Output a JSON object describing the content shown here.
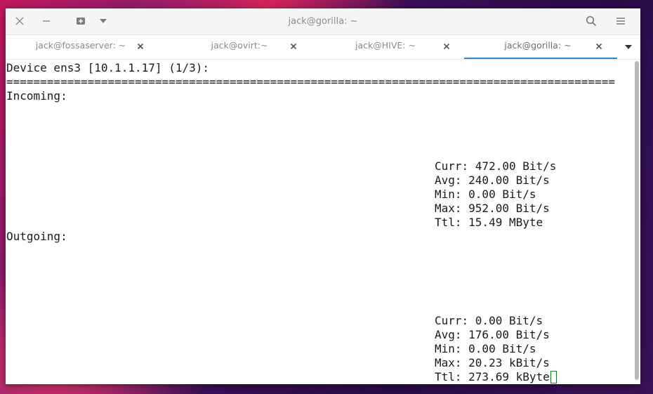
{
  "window": {
    "title": "jack@gorilla: ~"
  },
  "titlebar": {
    "icons": [
      "close-icon",
      "minimize-icon",
      "new-tab-icon",
      "chevron-down-icon",
      "search-icon",
      "hamburger-menu-icon"
    ]
  },
  "tabs": [
    {
      "label": "jack@fossaserver: ~",
      "active": false
    },
    {
      "label": "jack@ovirt:~",
      "active": false
    },
    {
      "label": "jack@HIVE: ~",
      "active": false
    },
    {
      "label": "jack@gorilla: ~",
      "active": true
    }
  ],
  "colors": {
    "accent": "#2f86d6",
    "cursor": "#1e7a2a"
  },
  "terminal": {
    "header": "Device ens3 [10.1.1.17] (1/3):",
    "separator": "==========================================================================================",
    "incoming_label": "Incoming:",
    "incoming": {
      "curr": "Curr: 472.00 Bit/s",
      "avg": "Avg: 240.00 Bit/s",
      "min": "Min: 0.00 Bit/s",
      "max": "Max: 952.00 Bit/s",
      "ttl": "Ttl: 15.49 MByte"
    },
    "outgoing_label": "Outgoing:",
    "outgoing": {
      "curr": "Curr: 0.00 Bit/s",
      "avg": "Avg: 176.00 Bit/s",
      "min": "Min: 0.00 Bit/s",
      "max": "Max: 20.23 kBit/s",
      "ttl": "Ttl: 273.69 kByte"
    }
  }
}
